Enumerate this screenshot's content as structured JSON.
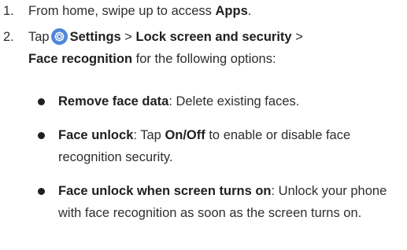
{
  "steps": [
    {
      "number": "1.",
      "prefix": "From home, swipe up to access ",
      "bold": "Apps",
      "suffix": "."
    },
    {
      "number": "2.",
      "tap": "Tap",
      "icon": "settings-gear-icon",
      "settings": "Settings",
      "sep1": " > ",
      "lock": "Lock screen and security",
      "sep2": " >",
      "face": "Face recognition",
      "rest": " for the following options:"
    }
  ],
  "options": [
    {
      "title": "Remove face data",
      "desc": ": Delete existing faces."
    },
    {
      "title": "Face unlock",
      "desc1": ": Tap ",
      "toggle": "On/Off",
      "desc2": " to enable or disable face recognition security."
    },
    {
      "title": "Face unlock when screen turns on",
      "desc": ": Unlock your phone with face recognition as soon as the screen turns on."
    }
  ],
  "colors": {
    "text": "#2e2e2e",
    "icon_bg": "#4f86d9"
  }
}
